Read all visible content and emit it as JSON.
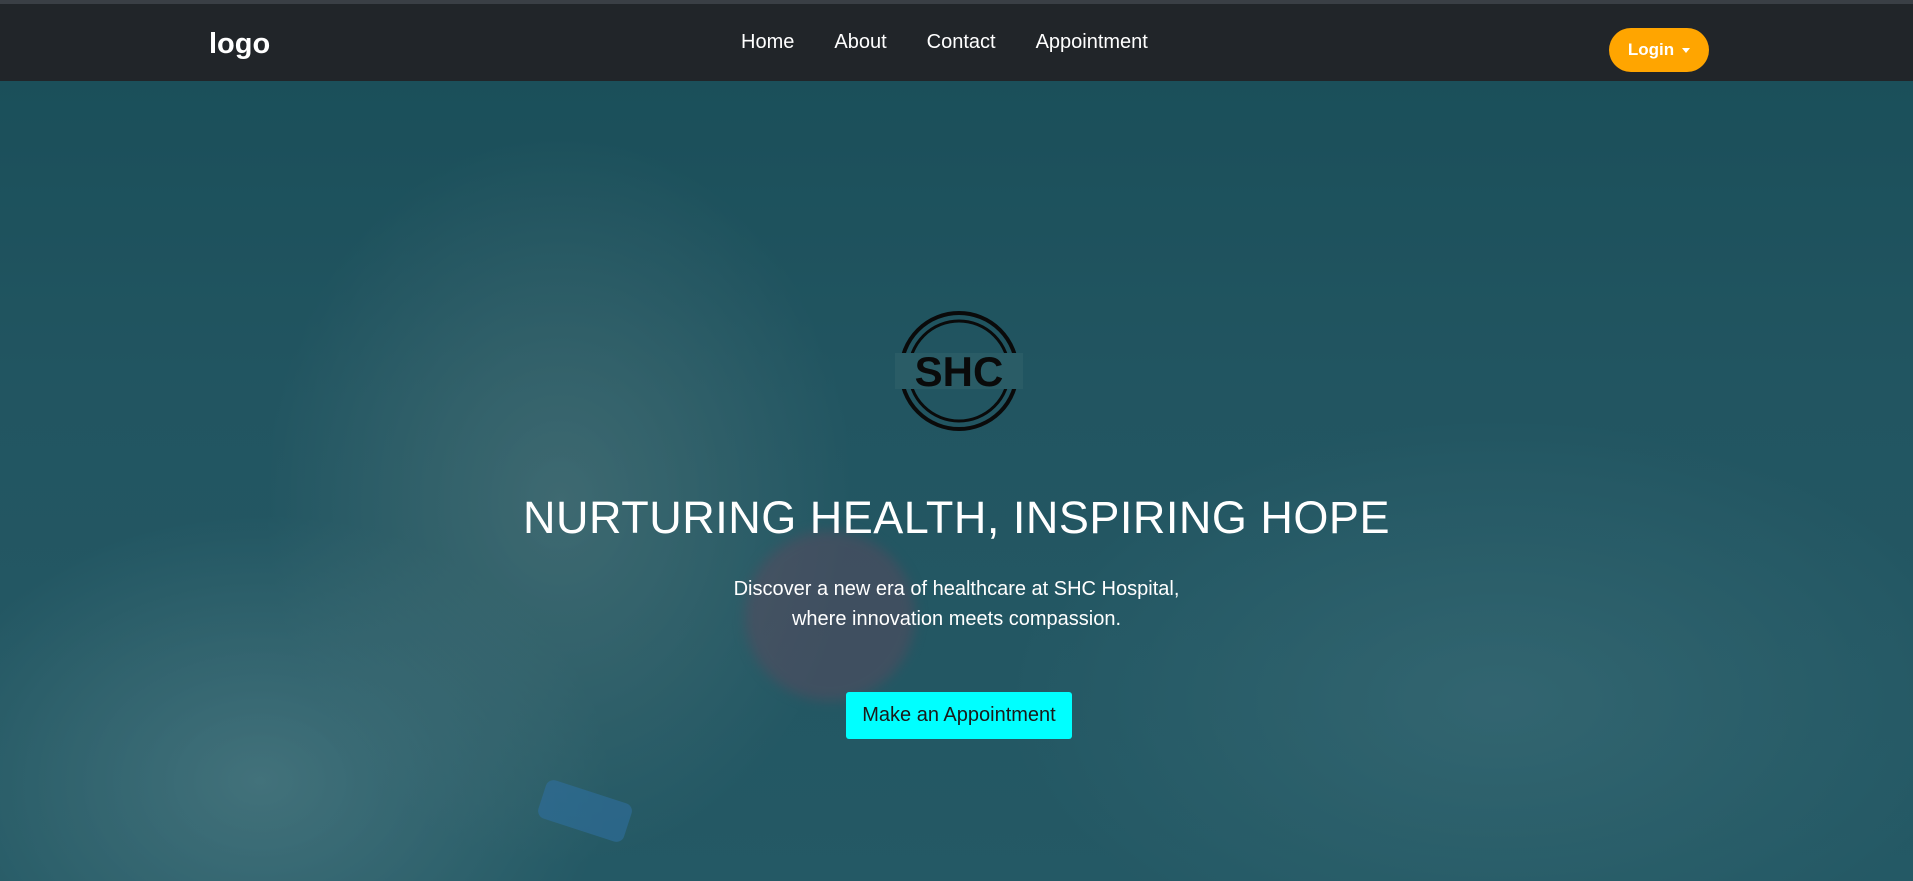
{
  "navbar": {
    "brand": "logo",
    "links": [
      "Home",
      "About",
      "Contact",
      "Appointment"
    ],
    "login_label": "Login"
  },
  "hero": {
    "emblem_text": "SHC",
    "title": "NURTURING HEALTH, INSPIRING HOPE",
    "subtitle_line1": "Discover a new era of healthcare at SHC Hospital,",
    "subtitle_line2": "where innovation meets compassion.",
    "cta_label": "Make an Appointment"
  },
  "colors": {
    "navbar_bg": "#212529",
    "login_accent": "#ffa500",
    "cta_accent": "#00ffff",
    "hero_tint": "#2a5f6b"
  },
  "icons": {
    "login_caret": "chevron-down-icon",
    "emblem": "shc-emblem-icon"
  }
}
